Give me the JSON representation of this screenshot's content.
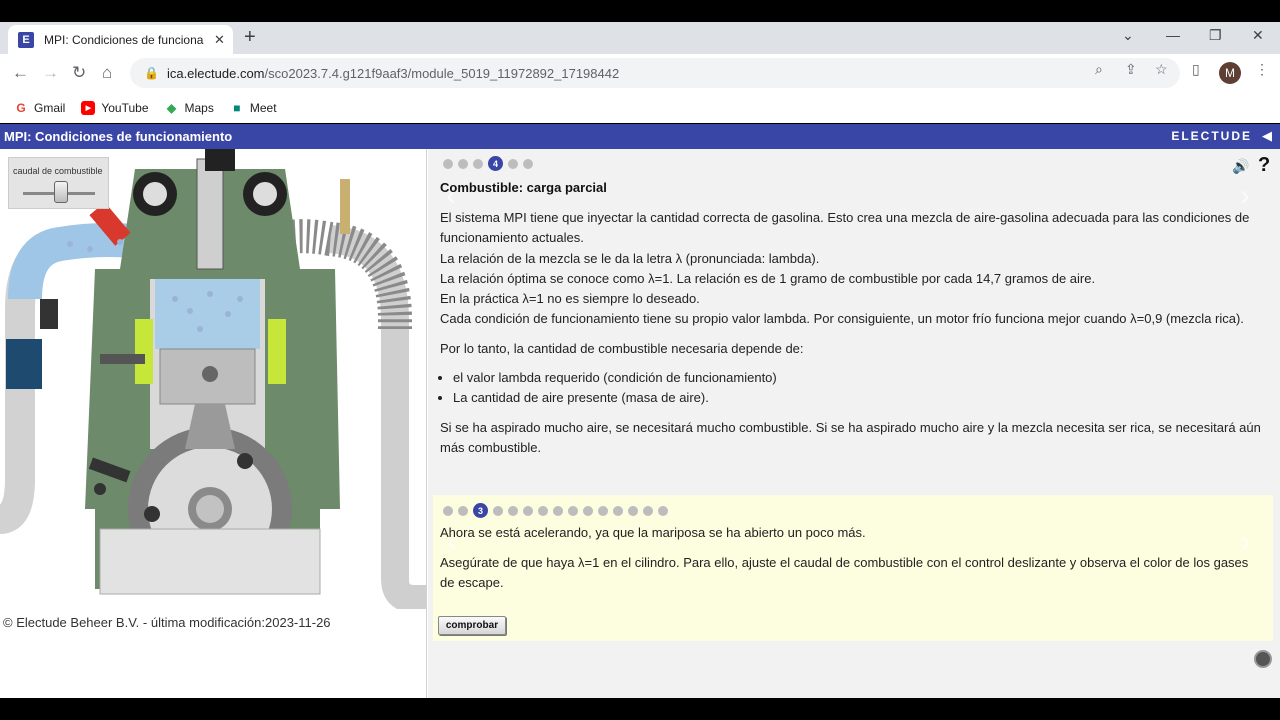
{
  "browser": {
    "tab_title": "MPI: Condiciones de funcionam",
    "favicon_letter": "E",
    "url_domain": "ica.electude.com",
    "url_path": "/sco2023.7.4.g121f9aaf3/module_5019_11972892_17198442",
    "avatar_letter": "M",
    "bookmarks": [
      {
        "label": "Gmail",
        "icon": "gmail-icon",
        "color": "#ea4335",
        "glyph": "G"
      },
      {
        "label": "YouTube",
        "icon": "youtube-icon",
        "color": "#ff0000",
        "glyph": "▶"
      },
      {
        "label": "Maps",
        "icon": "maps-icon",
        "color": "#34a853",
        "glyph": "◆"
      },
      {
        "label": "Meet",
        "icon": "meet-icon",
        "color": "#00897b",
        "glyph": "■"
      }
    ]
  },
  "app": {
    "title": "MPI: Condiciones de funcionamiento",
    "brand": "ELECTUDE",
    "accent": "#3a46a6"
  },
  "left": {
    "slider_label": "caudal de combustible",
    "slider_level": 0.55,
    "copyright": "© Electude Beheer B.V. - última modificación:2023-11-26"
  },
  "top_pager": {
    "active": "4",
    "before": 3,
    "after": 2
  },
  "content": {
    "title": "Combustible: carga parcial",
    "p1": "El sistema MPI tiene que inyectar la cantidad correcta de gasolina. Esto crea una mezcla de aire-gasolina adecuada para las condiciones de funcionamiento actuales.",
    "p2": "La relación de la mezcla se le da la letra λ (pronunciada: lambda).",
    "p3": "La relación óptima se conoce como λ=1. La relación es de 1 gramo de combustible por cada 14,7 gramos de aire.",
    "p4": "En la práctica λ=1 no es siempre lo deseado.",
    "p5": "Cada condición de funcionamiento tiene su propio valor lambda. Por consiguiente, un motor frío funciona mejor cuando λ=0,9 (mezcla rica).",
    "p6": "Por lo tanto, la cantidad de combustible necesaria depende de:",
    "bullet1": "el valor lambda requerido (condición de funcionamiento)",
    "bullet2": "La cantidad de aire presente (masa de aire).",
    "p7": "Si se ha aspirado mucho aire, se necesitará mucho combustible. Si se ha aspirado mucho aire y la mezcla necesita ser rica, se necesitará aún más combustible."
  },
  "task_pager": {
    "active": "3",
    "before": 2,
    "after": 12
  },
  "task": {
    "t1": "Ahora se está acelerando, ya que la mariposa se ha abierto un poco más.",
    "t2": "Asegúrate de que haya λ=1 en el cilindro. Para ello, ajuste el caudal de combustible con el control deslizante y observa el color de los gases de escape.",
    "button": "comprobar"
  }
}
